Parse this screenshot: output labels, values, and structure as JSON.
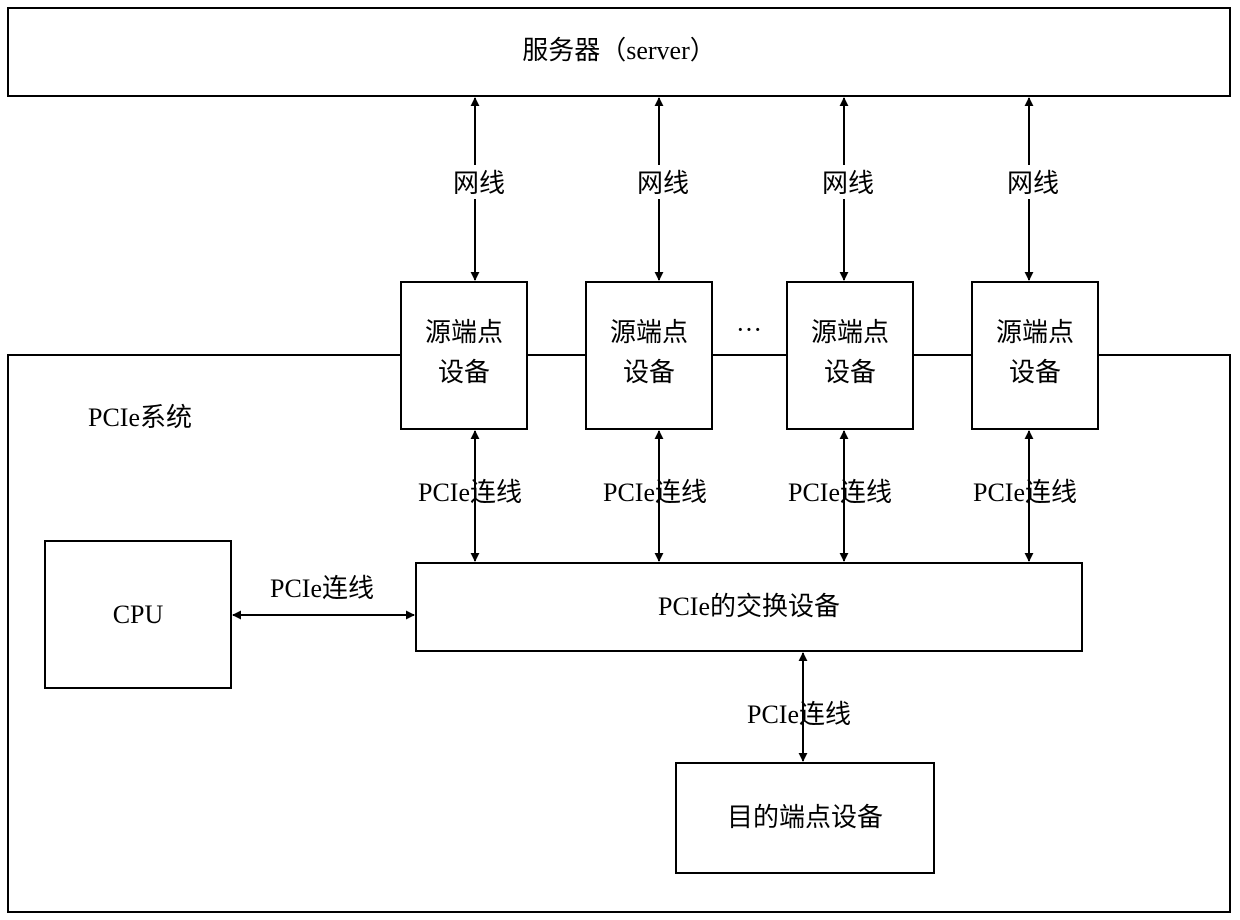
{
  "server": {
    "label": "服务器（server）"
  },
  "pcie_system": {
    "label": "PCIe系统"
  },
  "network_links": [
    {
      "label": "网线"
    },
    {
      "label": "网线"
    },
    {
      "label": "网线"
    },
    {
      "label": "网线"
    }
  ],
  "source_devices": [
    {
      "line1": "源端点",
      "line2": "设备"
    },
    {
      "line1": "源端点",
      "line2": "设备"
    },
    {
      "line1": "源端点",
      "line2": "设备"
    },
    {
      "line1": "源端点",
      "line2": "设备"
    }
  ],
  "ellipsis": "···",
  "pcie_links": [
    {
      "label": "PCIe连线"
    },
    {
      "label": "PCIe连线"
    },
    {
      "label": "PCIe连线"
    },
    {
      "label": "PCIe连线"
    }
  ],
  "cpu": {
    "label": "CPU"
  },
  "cpu_link": {
    "label": "PCIe连线"
  },
  "switch": {
    "label": "PCIe的交换设备"
  },
  "dest_link": {
    "label": "PCIe连线"
  },
  "destination": {
    "label": "目的端点设备"
  }
}
